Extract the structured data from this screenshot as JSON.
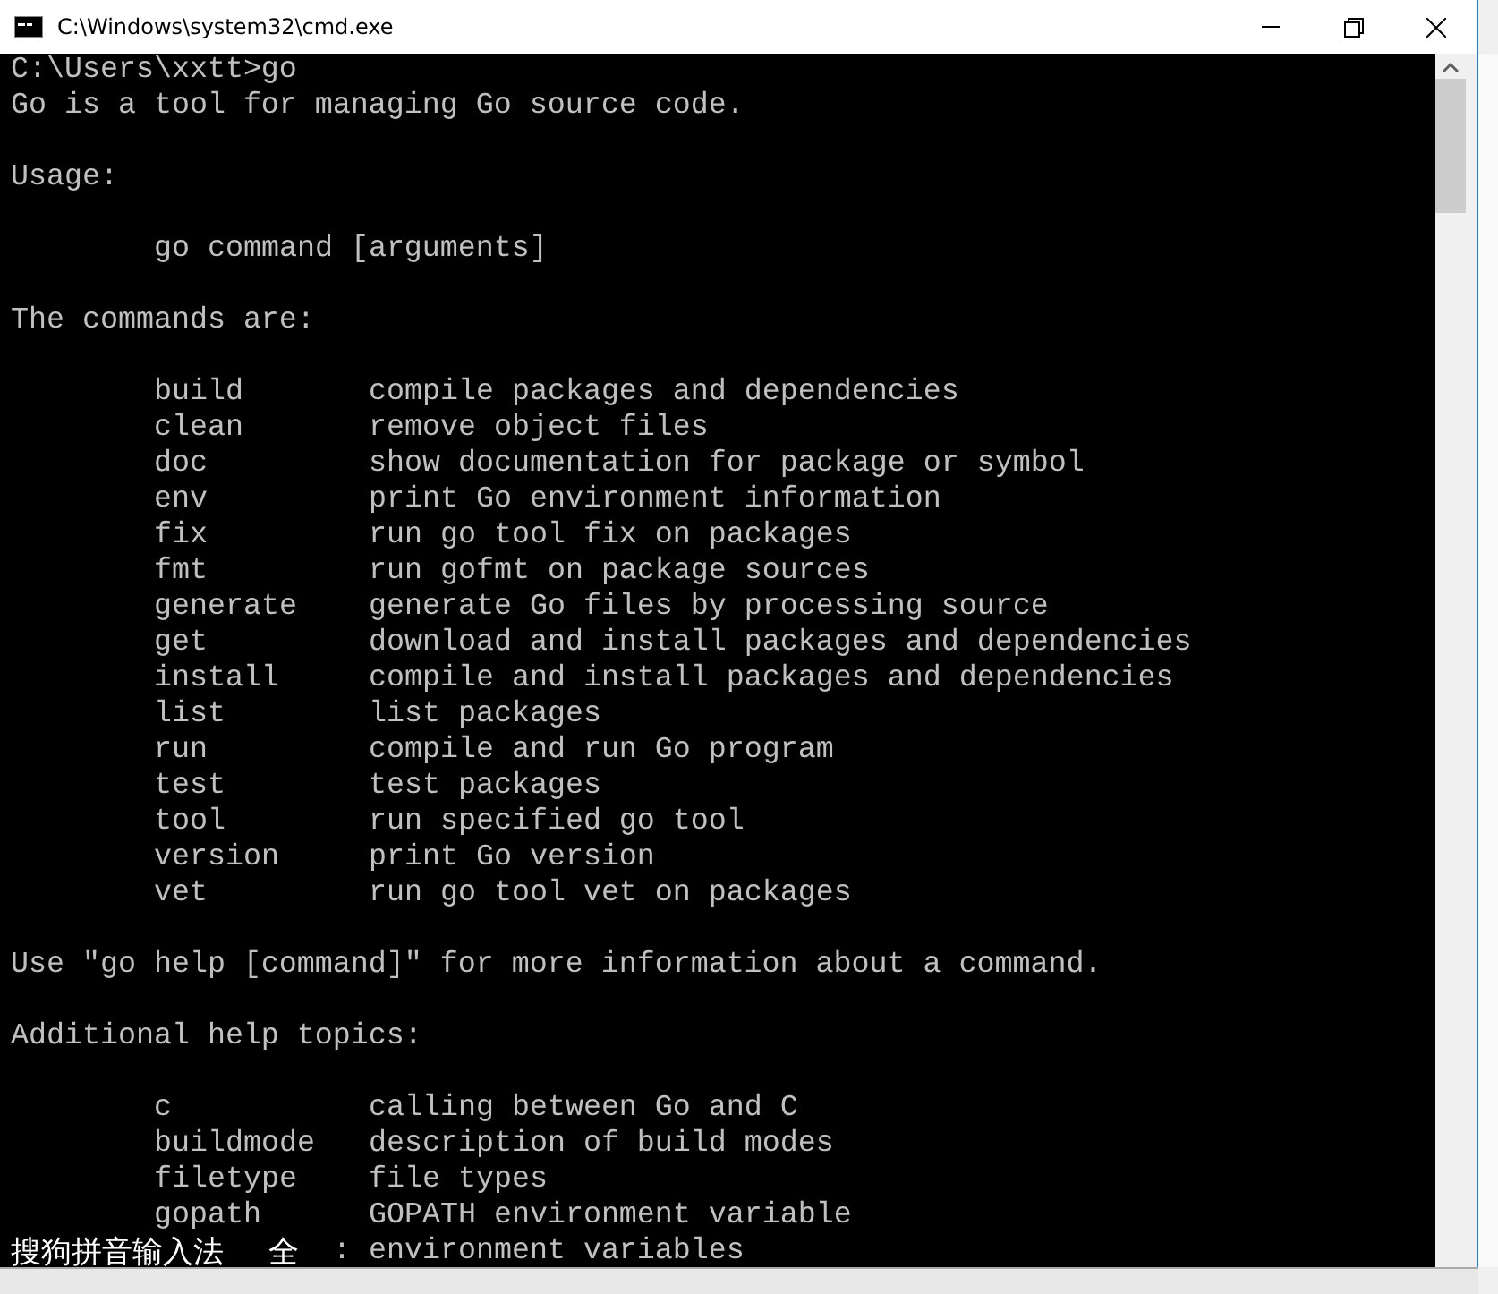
{
  "window": {
    "title": "C:\\Windows\\system32\\cmd.exe"
  },
  "console": {
    "lines": [
      {
        "kind": "text",
        "text": "C:\\Users\\xxtt>go"
      },
      {
        "kind": "text",
        "text": "Go is a tool for managing Go source code."
      },
      {
        "kind": "blank"
      },
      {
        "kind": "text",
        "text": "Usage:"
      },
      {
        "kind": "blank"
      },
      {
        "kind": "indented",
        "text": "go command [arguments]"
      },
      {
        "kind": "blank"
      },
      {
        "kind": "text",
        "text": "The commands are:"
      },
      {
        "kind": "blank"
      },
      {
        "kind": "entry",
        "name": "build",
        "description": "compile packages and dependencies"
      },
      {
        "kind": "entry",
        "name": "clean",
        "description": "remove object files"
      },
      {
        "kind": "entry",
        "name": "doc",
        "description": "show documentation for package or symbol"
      },
      {
        "kind": "entry",
        "name": "env",
        "description": "print Go environment information"
      },
      {
        "kind": "entry",
        "name": "fix",
        "description": "run go tool fix on packages"
      },
      {
        "kind": "entry",
        "name": "fmt",
        "description": "run gofmt on package sources"
      },
      {
        "kind": "entry",
        "name": "generate",
        "description": "generate Go files by processing source"
      },
      {
        "kind": "entry",
        "name": "get",
        "description": "download and install packages and dependencies"
      },
      {
        "kind": "entry",
        "name": "install",
        "description": "compile and install packages and dependencies"
      },
      {
        "kind": "entry",
        "name": "list",
        "description": "list packages"
      },
      {
        "kind": "entry",
        "name": "run",
        "description": "compile and run Go program"
      },
      {
        "kind": "entry",
        "name": "test",
        "description": "test packages"
      },
      {
        "kind": "entry",
        "name": "tool",
        "description": "run specified go tool"
      },
      {
        "kind": "entry",
        "name": "version",
        "description": "print Go version"
      },
      {
        "kind": "entry",
        "name": "vet",
        "description": "run go tool vet on packages"
      },
      {
        "kind": "blank"
      },
      {
        "kind": "text",
        "text": "Use \"go help [command]\" for more information about a command."
      },
      {
        "kind": "blank"
      },
      {
        "kind": "text",
        "text": "Additional help topics:"
      },
      {
        "kind": "blank"
      },
      {
        "kind": "entry",
        "name": "c",
        "description": "calling between Go and C"
      },
      {
        "kind": "entry",
        "name": "buildmode",
        "description": "description of build modes"
      },
      {
        "kind": "entry",
        "name": "filetype",
        "description": "file types"
      },
      {
        "kind": "entry",
        "name": "gopath",
        "description": "GOPATH environment variable"
      },
      {
        "kind": "ime",
        "ime": "搜狗拼音输入法",
        "mode": "全",
        "separator": ":",
        "description": "environment variables"
      }
    ]
  }
}
